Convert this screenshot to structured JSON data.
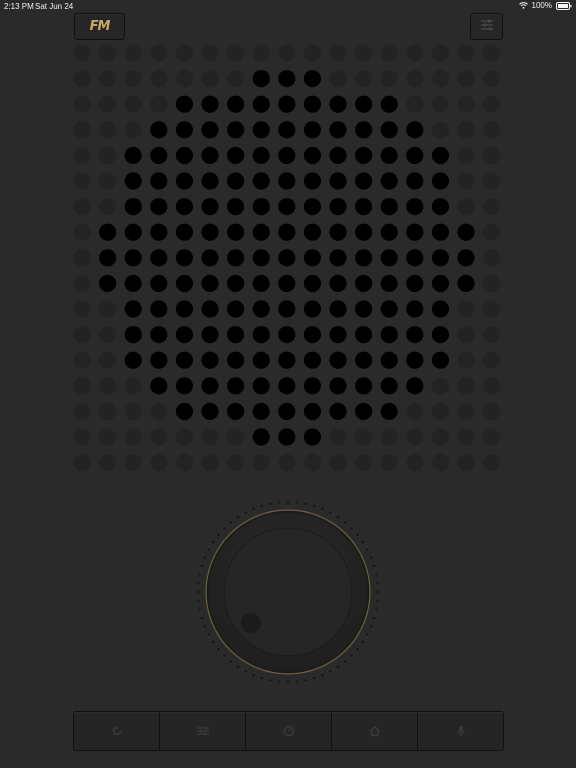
{
  "status_bar": {
    "time": "2:13 PM",
    "date": "Sat Jun 24",
    "battery": "100%"
  },
  "header": {
    "logo_text": "FM",
    "menu_icon": "sliders-icon"
  },
  "speaker": {
    "icon": "speaker-grille"
  },
  "dial": {
    "icon": "tuning-knob"
  },
  "bottom_bar": {
    "buttons": [
      {
        "icon": "refresh-icon"
      },
      {
        "icon": "equalizer-icon"
      },
      {
        "icon": "timer-icon"
      },
      {
        "icon": "home-icon"
      },
      {
        "icon": "microphone-icon"
      }
    ]
  },
  "colors": {
    "background": "#2a2a2a",
    "accent": "#caa96a",
    "dot_dim": "#232323",
    "dot_active": "#000000"
  }
}
